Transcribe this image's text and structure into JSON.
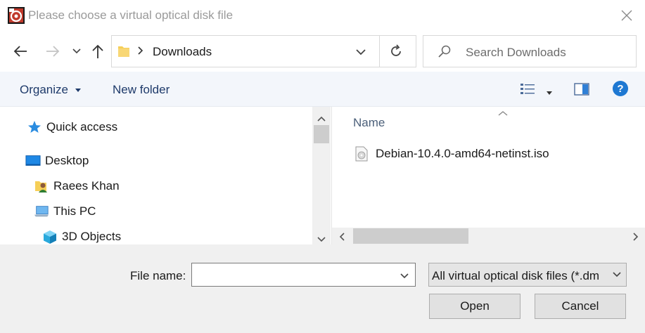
{
  "window": {
    "title": "Please choose a virtual optical disk file"
  },
  "nav": {
    "address_path": "Downloads",
    "search_placeholder": "Search Downloads"
  },
  "toolbar": {
    "organize_label": "Organize",
    "new_folder_label": "New folder"
  },
  "sidebar": {
    "items": [
      {
        "label": "Quick access",
        "icon": "star-icon"
      },
      {
        "label": "Desktop",
        "icon": "desktop-icon"
      },
      {
        "label": "Raees Khan",
        "icon": "user-folder-icon"
      },
      {
        "label": "This PC",
        "icon": "computer-icon"
      },
      {
        "label": "3D Objects",
        "icon": "cube-icon"
      }
    ]
  },
  "file_list": {
    "column_name": "Name",
    "files": [
      {
        "name": "Debian-10.4.0-amd64-netinst.iso",
        "icon": "disc-image-icon"
      }
    ]
  },
  "footer": {
    "file_name_label": "File name:",
    "file_name_value": "",
    "file_type_value": "All virtual optical disk files (*.dm",
    "open_label": "Open",
    "cancel_label": "Cancel"
  },
  "colors": {
    "accent_blue": "#1e78d2",
    "toolbar_bg": "#f3f6fb",
    "footer_bg": "#f0f0f0"
  }
}
